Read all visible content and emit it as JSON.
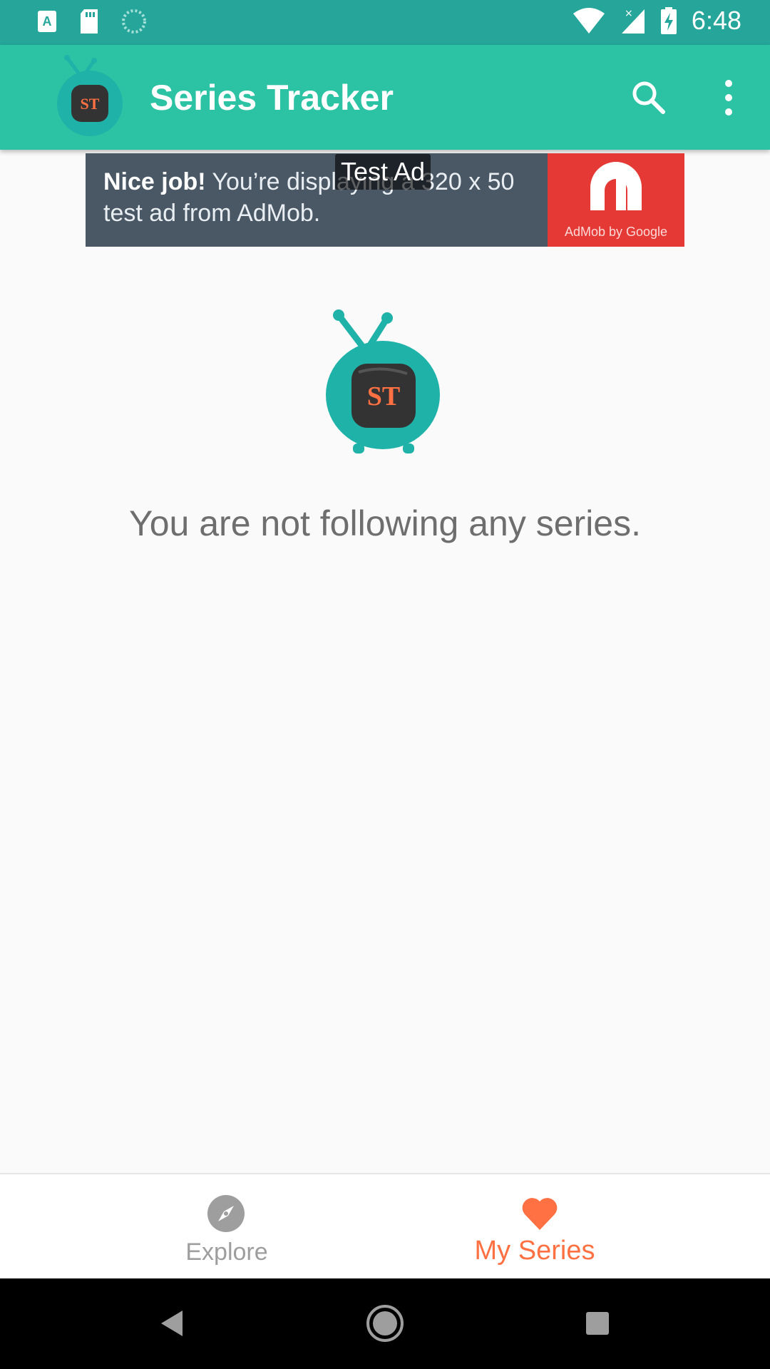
{
  "status_bar": {
    "time": "6:48",
    "left_icons": [
      "a-notification-icon",
      "sd-card-icon",
      "sync-icon"
    ],
    "right_icons": [
      "wifi-icon",
      "signal-icon",
      "battery-charging-icon"
    ]
  },
  "app_bar": {
    "title": "Series Tracker",
    "logo_text": "ST",
    "actions": [
      "search-icon",
      "more-vert-icon"
    ]
  },
  "ad": {
    "label": "Test Ad",
    "bold_text": "Nice job!",
    "text_line1": " You’re displaying a 320 x 50",
    "text_line2": "test ad from AdMob.",
    "logo_caption": "AdMob by Google"
  },
  "empty_state": {
    "logo_text": "ST",
    "message": "You are not following any series."
  },
  "bottom_nav": {
    "items": [
      {
        "label": "Explore",
        "icon": "compass-icon",
        "selected": false
      },
      {
        "label": "My Series",
        "icon": "heart-icon",
        "selected": true
      }
    ]
  },
  "colors": {
    "status_bar": "#26a69a",
    "app_bar": "#2cc2a4",
    "accent": "#ff7043",
    "tv_teal": "#1fb2a8"
  }
}
